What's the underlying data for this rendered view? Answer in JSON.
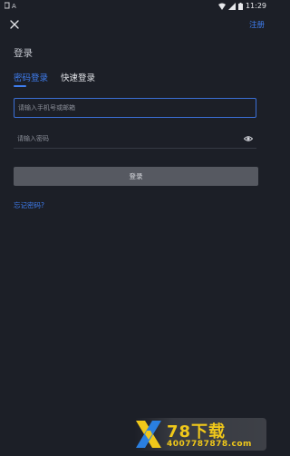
{
  "status_bar": {
    "time": "11:29"
  },
  "header": {
    "register_label": "注册"
  },
  "page_title": "登录",
  "tabs": [
    {
      "label": "密码登录",
      "active": true
    },
    {
      "label": "快速登录",
      "active": false
    }
  ],
  "form": {
    "account_placeholder": "请输入手机号或邮箱",
    "account_value": "",
    "password_placeholder": "请输入密码",
    "password_value": "",
    "login_button": "登录",
    "forgot_password": "忘记密码?"
  },
  "watermark": {
    "brand": "78下载",
    "phone": "4007787878.com"
  },
  "colors": {
    "background": "#1c1f27",
    "accent": "#3f7ef0",
    "button_disabled": "#565961"
  },
  "icons": {
    "close": "close-icon",
    "eye": "eye-icon",
    "wifi": "wifi-icon",
    "signal": "signal-icon",
    "battery": "battery-icon"
  }
}
